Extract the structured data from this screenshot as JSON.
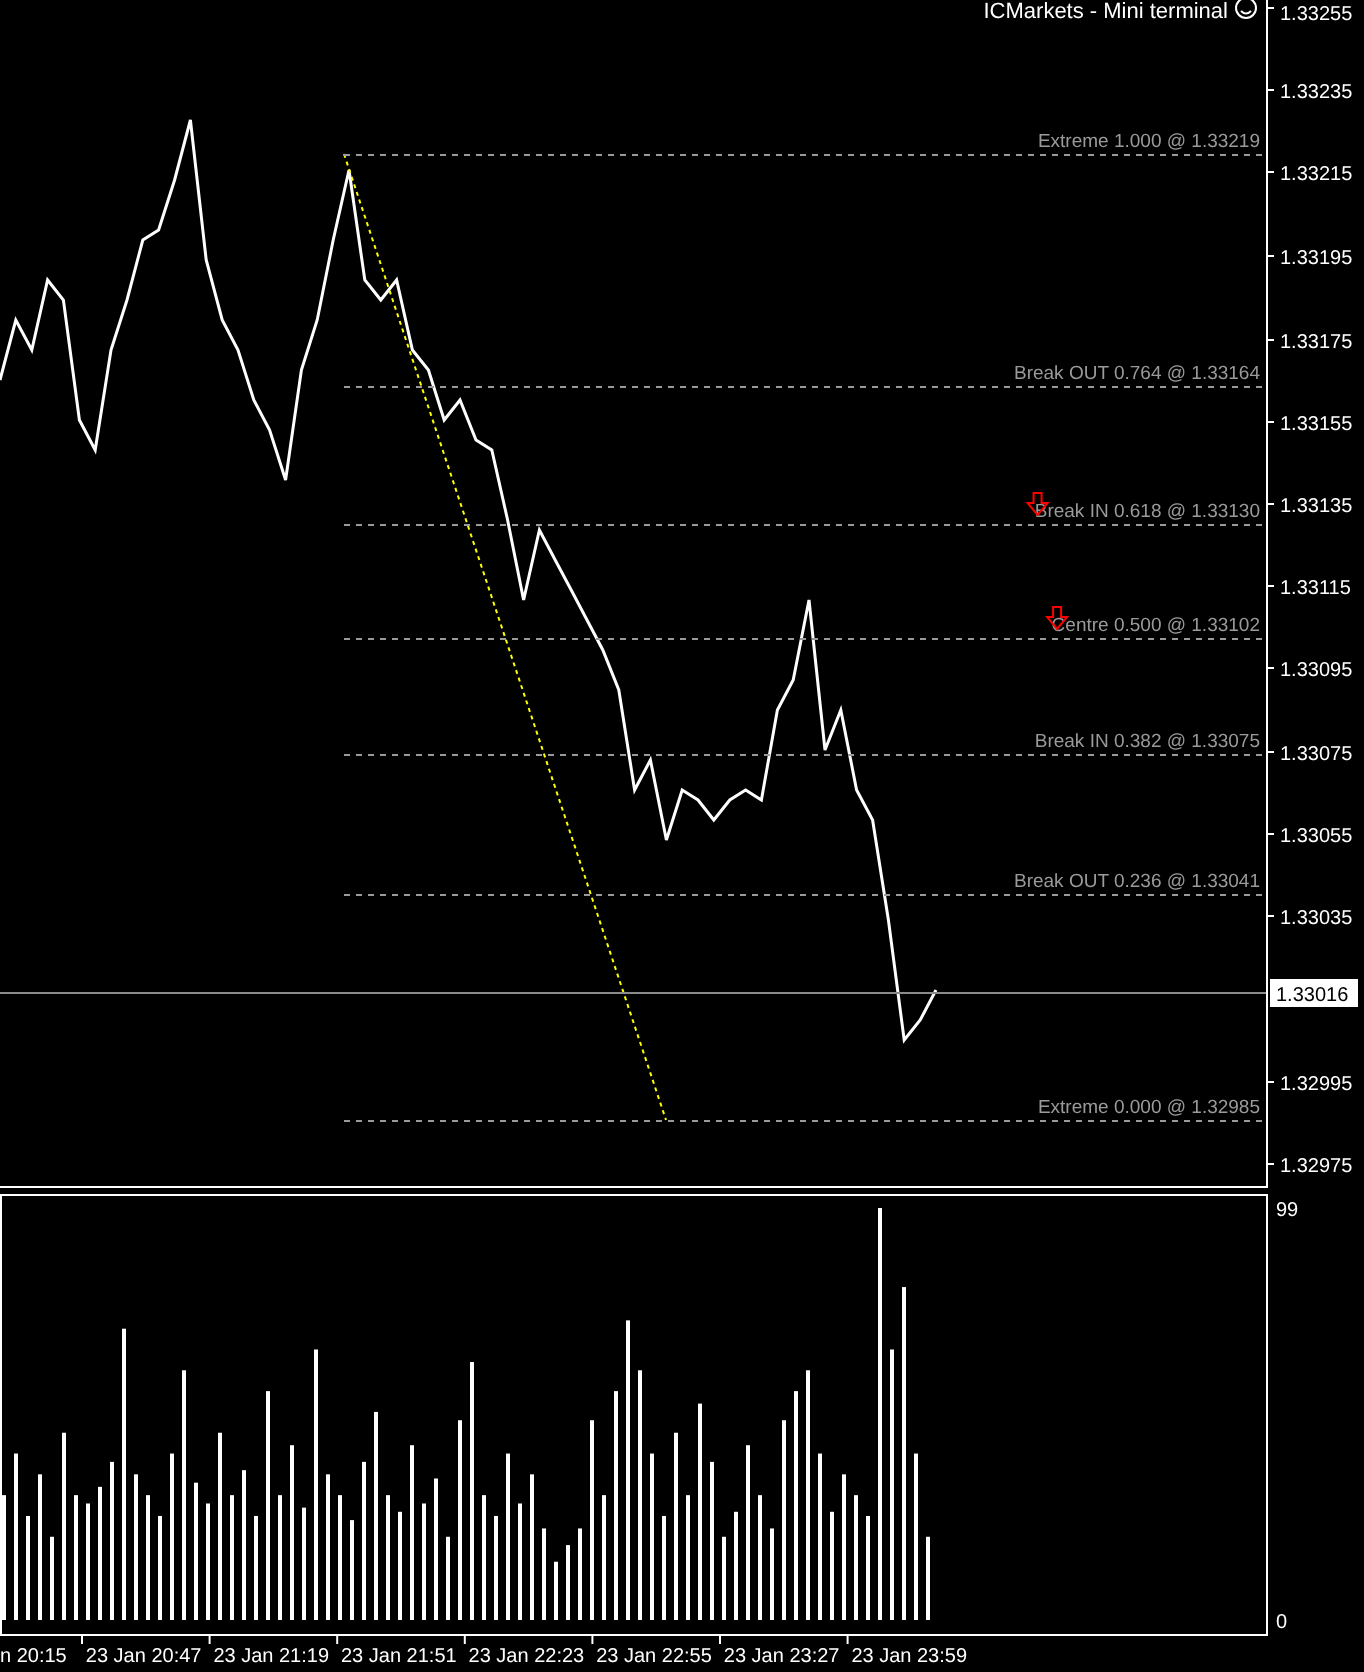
{
  "header": {
    "title": "ICMarkets - Mini terminal"
  },
  "price_axis": {
    "labels": [
      "1.33255",
      "1.33235",
      "1.33215",
      "1.33195",
      "1.33175",
      "1.33155",
      "1.33135",
      "1.33115",
      "1.33095",
      "1.33075",
      "1.33055",
      "1.33035",
      "1.32995",
      "1.32975"
    ]
  },
  "fib_levels": [
    {
      "label": "Extreme 1.000 @ 1.33219",
      "arrow": false
    },
    {
      "label": "Break OUT 0.764 @ 1.33164",
      "arrow": false
    },
    {
      "label": "Break IN 0.618 @ 1.33130",
      "arrow": true
    },
    {
      "label": "Centre 0.500 @ 1.33102",
      "arrow": true
    },
    {
      "label": "Break IN 0.382 @ 1.33075",
      "arrow": false
    },
    {
      "label": "Break OUT 0.236 @ 1.33041",
      "arrow": false
    },
    {
      "label": "Extreme 0.000 @ 1.32985",
      "arrow": false
    }
  ],
  "current_price": {
    "label": "1.33016"
  },
  "volume_axis": {
    "labels": [
      "99",
      "0"
    ]
  },
  "time_axis": {
    "labels": [
      "n 20:15",
      "23 Jan 20:47",
      "23 Jan 21:19",
      "23 Jan 21:51",
      "23 Jan 22:23",
      "23 Jan 22:55",
      "23 Jan 23:27",
      "23 Jan 23:59"
    ]
  }
}
